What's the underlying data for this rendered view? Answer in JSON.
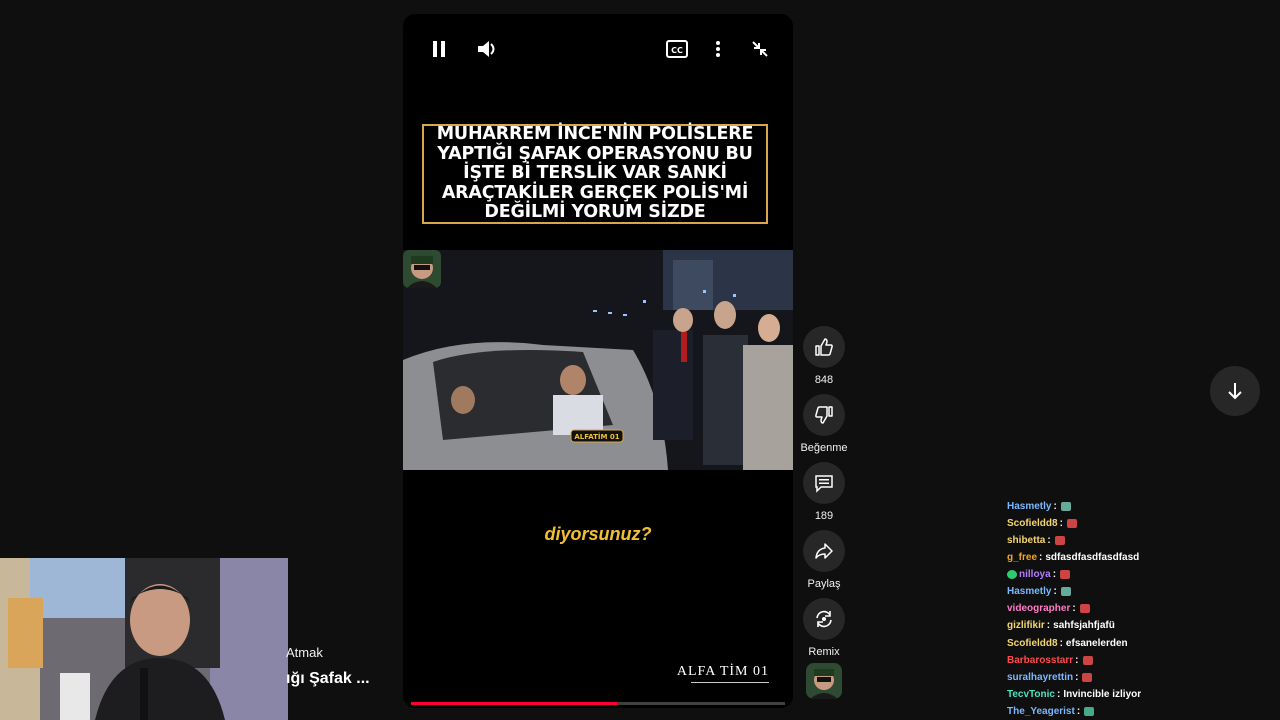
{
  "video": {
    "overlay_title": "MUHARREM İNCE'NİN POLİSLERE YAPTIĞI ŞAFAK OPERASYONU BU İŞTE Bİ TERSLİK VAR SANKİ ARAÇTAKİLER GERÇEK POLİS'Mİ DEĞİLMİ YORUM SİZDE",
    "plate_text": "ALFATİM 01",
    "caption": "diyorsunuz?",
    "watermark": "ALFA TİM 01",
    "progress": 0.55,
    "controls": {
      "pause_icon": "pause-icon",
      "volume_icon": "volume-icon",
      "cc_label": "CC",
      "more_icon": "more-vert-icon",
      "minimize_icon": "exit-fullscreen-icon"
    }
  },
  "actions": {
    "like": {
      "icon": "thumb-up-icon",
      "label": "848"
    },
    "dislike": {
      "icon": "thumb-down-icon",
      "label": "Beğenme"
    },
    "comments": {
      "icon": "comment-icon",
      "label": "189"
    },
    "share": {
      "icon": "share-icon",
      "label": "Paylaş"
    },
    "remix": {
      "icon": "remix-icon",
      "label": "Remix"
    }
  },
  "side": {
    "line1": "Atmak",
    "line2": "ığı Şafak ..."
  },
  "chat": [
    {
      "user": "Hasmetly",
      "color": "#7ab8ff",
      "text": "",
      "emote": "#6a9"
    },
    {
      "user": "Scofieldd8",
      "color": "#f5d76e",
      "text": "",
      "emote": "#c44"
    },
    {
      "user": "shibetta",
      "color": "#f5d76e",
      "text": "",
      "emote": "#c44"
    },
    {
      "user": "g_free",
      "color": "#f5a623",
      "text": "sdfasdfasdfasdfasd",
      "emote": ""
    },
    {
      "user": "nilloya",
      "color": "#b57bff",
      "text": "",
      "emote": "#c44",
      "badge": "#2ecc71"
    },
    {
      "user": "Hasmetly",
      "color": "#7ab8ff",
      "text": "",
      "emote": "#6a9"
    },
    {
      "user": "videographer",
      "color": "#ff7ac8",
      "text": "",
      "emote": "#c44"
    },
    {
      "user": "gizlifikir",
      "color": "#f5d76e",
      "text": "sahfsjahfjafü",
      "emote": ""
    },
    {
      "user": "Scofieldd8",
      "color": "#f5d76e",
      "text": "efsanelerden",
      "emote": ""
    },
    {
      "user": "Barbarosstarr",
      "color": "#ff4b4b",
      "text": "",
      "emote": "#c44"
    },
    {
      "user": "suralhayrettin",
      "color": "#7ab8ff",
      "text": "",
      "emote": "#c44"
    },
    {
      "user": "TecvTonic",
      "color": "#4be3c1",
      "text": "Invincible izliyor",
      "emote": ""
    },
    {
      "user": "The_Yeagerist",
      "color": "#7ab8ff",
      "text": "",
      "emote": "#4a8"
    }
  ]
}
